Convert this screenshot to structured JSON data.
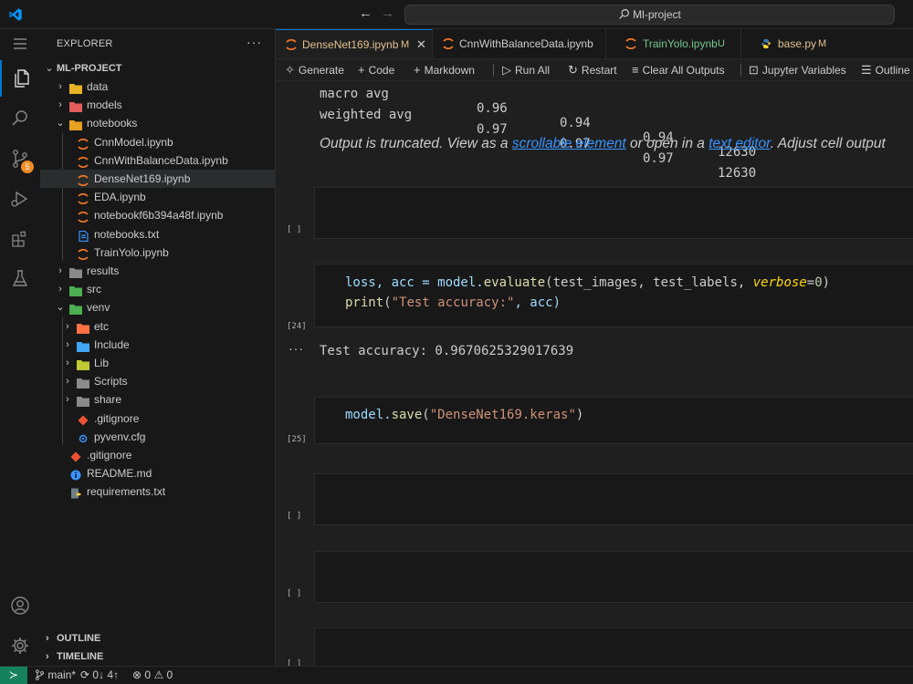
{
  "titlebar": {
    "search_text": "Ml-project",
    "back_symbol": "←",
    "forward_symbol": "→"
  },
  "activity_bar": {
    "source_control_badge": "5"
  },
  "explorer": {
    "header": "EXPLORER",
    "more_symbol": "···",
    "root": "ML-PROJECT",
    "items": [
      {
        "label": "data",
        "depth": 1,
        "kind": "folder",
        "expanded": false
      },
      {
        "label": "models",
        "depth": 1,
        "kind": "folder",
        "expanded": false
      },
      {
        "label": "notebooks",
        "depth": 1,
        "kind": "folder",
        "expanded": true
      },
      {
        "label": "CnnModel.ipynb",
        "depth": 2,
        "kind": "notebook"
      },
      {
        "label": "CnnWithBalanceData.ipynb",
        "depth": 2,
        "kind": "notebook"
      },
      {
        "label": "DenseNet169.ipynb",
        "depth": 2,
        "kind": "notebook",
        "selected": true
      },
      {
        "label": "EDA.ipynb",
        "depth": 2,
        "kind": "notebook"
      },
      {
        "label": "notebookf6b394a48f.ipynb",
        "depth": 2,
        "kind": "notebook"
      },
      {
        "label": "notebooks.txt",
        "depth": 2,
        "kind": "text"
      },
      {
        "label": "TrainYolo.ipynb",
        "depth": 2,
        "kind": "notebook"
      },
      {
        "label": "results",
        "depth": 1,
        "kind": "folder",
        "expanded": false
      },
      {
        "label": "src",
        "depth": 1,
        "kind": "folder",
        "expanded": false
      },
      {
        "label": "venv",
        "depth": 1,
        "kind": "folder",
        "expanded": true
      },
      {
        "label": "etc",
        "depth": 2,
        "kind": "folder",
        "expanded": false
      },
      {
        "label": "Include",
        "depth": 2,
        "kind": "folder",
        "expanded": false
      },
      {
        "label": "Lib",
        "depth": 2,
        "kind": "folder",
        "expanded": false
      },
      {
        "label": "Scripts",
        "depth": 2,
        "kind": "folder",
        "expanded": false
      },
      {
        "label": "share",
        "depth": 2,
        "kind": "folder",
        "expanded": false
      },
      {
        "label": ".gitignore",
        "depth": 2,
        "kind": "git"
      },
      {
        "label": "pyvenv.cfg",
        "depth": 2,
        "kind": "config"
      },
      {
        "label": ".gitignore",
        "depth": 1,
        "kind": "git"
      },
      {
        "label": "README.md",
        "depth": 1,
        "kind": "info"
      },
      {
        "label": "requirements.txt",
        "depth": 1,
        "kind": "requirements"
      }
    ],
    "outline_label": "OUTLINE",
    "timeline_label": "TIMELINE"
  },
  "tabs": [
    {
      "label": "DenseNet169.ipynb",
      "modifier": "M",
      "active": true,
      "close": "✕",
      "color": "#e2c08d"
    },
    {
      "label": "CnnWithBalanceData.ipynb",
      "modifier": "",
      "active": false,
      "color": "#cccccc"
    },
    {
      "label": "TrainYolo.ipynb",
      "modifier": "U",
      "active": false,
      "color": "#73c991"
    },
    {
      "label": "base.py",
      "modifier": "M",
      "active": false,
      "color": "#e2c08d"
    }
  ],
  "notebook_toolbar": {
    "generate": "Generate",
    "code": "Code",
    "markdown": "Markdown",
    "run_all": "Run All",
    "restart": "Restart",
    "clear_all_outputs": "Clear All Outputs",
    "jupyter_variables": "Jupyter Variables",
    "outline": "Outline"
  },
  "notebook": {
    "report_rows": [
      {
        "label": "macro avg",
        "precision": "0.96",
        "recall": "0.94",
        "f1": "0.94",
        "support": "12630"
      },
      {
        "label": "weighted avg",
        "precision": "0.97",
        "recall": "0.97",
        "f1": "0.97",
        "support": "12630"
      }
    ],
    "truncated": {
      "prefix": "Output is truncated. View as a ",
      "link1": "scrollable element",
      "middle": " or open in a ",
      "link2": "text editor",
      "suffix": ". Adjust cell output"
    },
    "cells": [
      {
        "exec": "[ ]"
      },
      {
        "exec": "[24]"
      },
      {
        "exec": "[25]"
      },
      {
        "exec": "[ ]"
      },
      {
        "exec": "[ ]"
      },
      {
        "exec": "[ ]"
      }
    ],
    "cell24_line1": {
      "a": "loss, acc = model.",
      "fn": "evaluate",
      "b": "(test_images, test_labels, ",
      "param": "verbose",
      "eq": "=",
      "num": "0",
      "c": ")"
    },
    "cell24_line2": {
      "fn": "print",
      "a": "(",
      "str": "\"Test accuracy:\"",
      "b": ", acc)"
    },
    "output_dots": "···",
    "cell24_output": "Test accuracy: 0.9670625329017639",
    "cell25_line1": {
      "a": "model.",
      "fn": "save",
      "b": "(",
      "str": "\"DenseNet169.keras\"",
      "c": ")"
    }
  },
  "statusbar": {
    "remote_symbol": "≻",
    "branch": "main*",
    "sync": "0↓ 4↑",
    "errors": "0",
    "warnings": "0"
  }
}
